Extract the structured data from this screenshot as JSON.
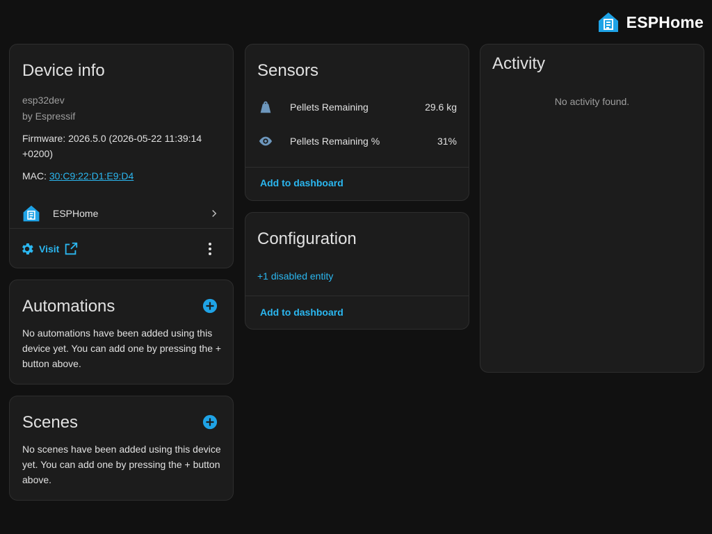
{
  "header": {
    "brand": "ESPHome"
  },
  "device_info": {
    "title": "Device info",
    "model": "esp32dev",
    "manufacturer": "by Espressif",
    "firmware": "Firmware: 2026.5.0 (2026-05-22 11:39:14 +0200)",
    "mac_label": "MAC: ",
    "mac_value": "30:C9:22:D1:E9:D4",
    "integration": "ESPHome",
    "visit_label": "Visit"
  },
  "automations": {
    "title": "Automations",
    "description": "No automations have been added using this device yet. You can add one by pressing the + button above."
  },
  "scenes": {
    "title": "Scenes",
    "description": "No scenes have been added using this device yet. You can add one by pressing the + button above."
  },
  "sensors": {
    "title": "Sensors",
    "items": [
      {
        "label": "Pellets Remaining",
        "value": "29.6 kg",
        "icon": "weight-icon"
      },
      {
        "label": "Pellets Remaining %",
        "value": "31%",
        "icon": "eye-icon"
      }
    ],
    "add_to_dashboard": "Add to dashboard"
  },
  "configuration": {
    "title": "Configuration",
    "disabled_entities": "+1 disabled entity",
    "add_to_dashboard": "Add to dashboard"
  },
  "activity": {
    "title": "Activity",
    "empty": "No activity found."
  },
  "colors": {
    "background": "#111111",
    "card": "#1c1c1c",
    "accent": "#2bb7f0",
    "brand": "#1fa3e6",
    "icon_muted": "#6d97bd"
  }
}
